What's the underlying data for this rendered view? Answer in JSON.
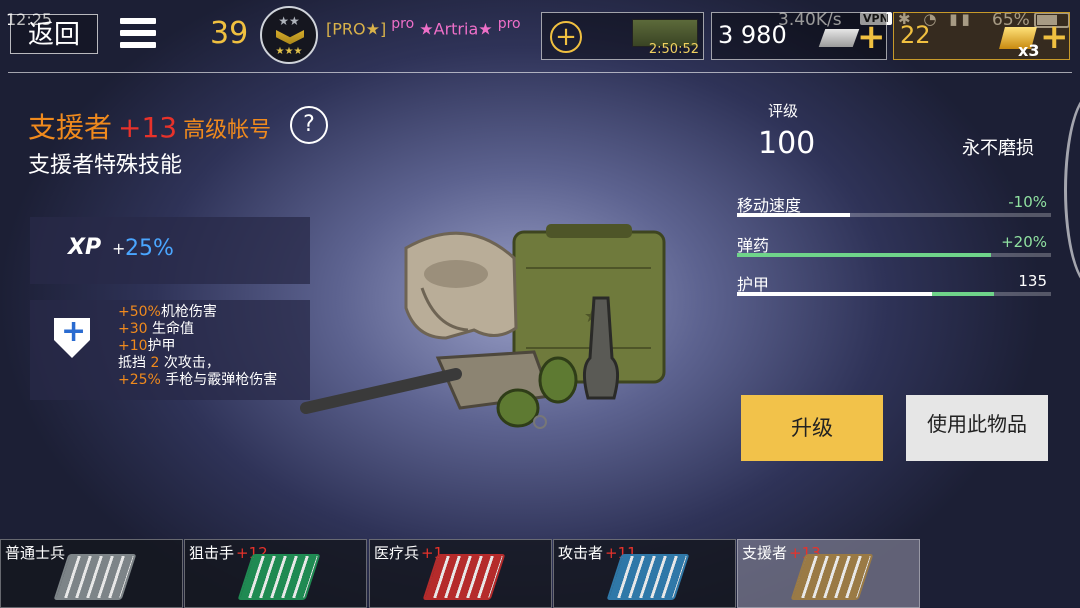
{
  "status_bar": {
    "time": "12:25",
    "speed": "3.40K/s",
    "vpn": "VPN",
    "battery": "65%"
  },
  "hud": {
    "back_label": "返回",
    "player_level": "39",
    "player_tag": "[PRO★]",
    "pro_prefix": "pro",
    "player_name": "★Artria★",
    "pro_suffix": "pro",
    "crate_timer": "2:50:52",
    "money": "3 980",
    "gold": "22",
    "gold_multiplier": "x3",
    "plus": "+"
  },
  "class_info": {
    "name": "支援者",
    "level": "+13",
    "premium": "高级帐号",
    "help": "?",
    "subtitle": "支援者特殊技能",
    "xp_label": "XP",
    "xp_plus": "+",
    "xp_value": "25%",
    "skills": [
      {
        "hi": "+50%",
        "text": "机枪伤害"
      },
      {
        "hi": "+30",
        "text": " 生命值"
      },
      {
        "hi": "+10",
        "text": "护甲"
      },
      {
        "pre": "抵挡 ",
        "hi": "2",
        "text": " 次攻击，"
      },
      {
        "hi": "+25%",
        "text": " 手枪与霰弹枪伤害"
      }
    ]
  },
  "item": {
    "rating_label": "评级",
    "rating_value": "100",
    "durability": "永不磨损",
    "stats": [
      {
        "label": "移动速度",
        "value": "-10%",
        "base": 0.36,
        "bonus": 0.0
      },
      {
        "label": "弹药",
        "value": "+20%",
        "base": 0.0,
        "bonus": 0.81
      },
      {
        "label": "护甲",
        "value": "135",
        "base": 0.62,
        "bonus": 0.2
      }
    ],
    "upgrade_label": "升级",
    "use_label": "使用此物品"
  },
  "tabs": [
    {
      "name": "普通士兵",
      "level": "",
      "color": "#7d8488"
    },
    {
      "name": "狙击手",
      "level": "+12",
      "color": "#1f8a52"
    },
    {
      "name": "医疗兵",
      "level": "+1",
      "color": "#b52b2b"
    },
    {
      "name": "攻击者",
      "level": "+11",
      "color": "#2f78a8"
    },
    {
      "name": "支援者",
      "level": "+13",
      "color": "#9a7a45"
    }
  ],
  "colors": {
    "accent_orange": "#f08a1d",
    "level_red": "#e8322a",
    "xp_blue": "#4aa6ff",
    "stat_green": "#6fd48a",
    "upgrade_yellow": "#f2c24a"
  }
}
